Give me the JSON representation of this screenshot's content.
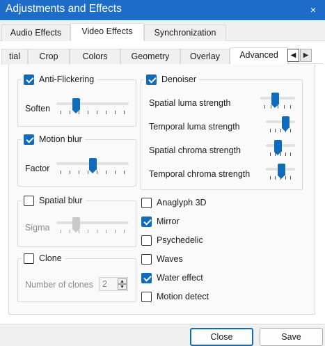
{
  "window": {
    "title": "Adjustments and Effects",
    "close_glyph": "×"
  },
  "main_tabs": [
    {
      "label": "Audio Effects"
    },
    {
      "label": "Video Effects"
    },
    {
      "label": "Synchronization"
    }
  ],
  "sub_tabs": [
    {
      "label": "tial"
    },
    {
      "label": "Crop"
    },
    {
      "label": "Colors"
    },
    {
      "label": "Geometry"
    },
    {
      "label": "Overlay"
    },
    {
      "label": "Advanced"
    }
  ],
  "tab_scroll": {
    "left": "◀",
    "right": "▶"
  },
  "anti_flickering": {
    "label": "Anti-Flickering",
    "checked": true,
    "soften_label": "Soften",
    "soften_level": 0.25
  },
  "motion_blur": {
    "label": "Motion blur",
    "checked": true,
    "factor_label": "Factor",
    "factor_level": 0.5
  },
  "spatial_blur": {
    "label": "Spatial blur",
    "checked": false,
    "sigma_label": "Sigma",
    "sigma_level": 0.25
  },
  "clone": {
    "label": "Clone",
    "checked": false,
    "count_label": "Number of clones",
    "count_value": "2",
    "up": "▲",
    "down": "▼"
  },
  "denoiser": {
    "label": "Denoiser",
    "checked": true,
    "spatial_luma": "Spatial luma strength",
    "temporal_luma": "Temporal luma strength",
    "spatial_chroma": "Spatial chroma strength",
    "temporal_chroma": "Temporal chroma strength",
    "spatial_luma_level": 0.4,
    "temporal_luma_level": 0.75,
    "spatial_chroma_level": 0.4,
    "temporal_chroma_level": 0.55
  },
  "effects": [
    {
      "label": "Anaglyph 3D",
      "checked": false
    },
    {
      "label": "Mirror",
      "checked": true
    },
    {
      "label": "Psychedelic",
      "checked": false
    },
    {
      "label": "Waves",
      "checked": false
    },
    {
      "label": "Water effect",
      "checked": true
    },
    {
      "label": "Motion detect",
      "checked": false
    }
  ],
  "buttons": {
    "close": "Close",
    "save": "Save"
  },
  "colors": {
    "accent": "#0f6cbd",
    "titlebar": "#1e6cc9"
  }
}
